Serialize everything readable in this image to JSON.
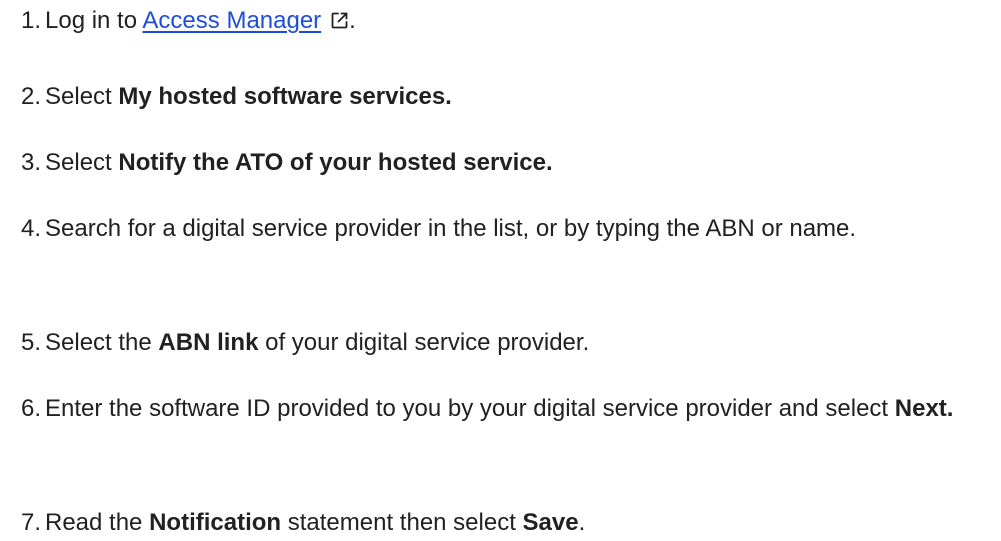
{
  "steps": [
    {
      "number": "1.",
      "before": "Log in to ",
      "link": "Access Manager",
      "link_icon": "external-link-icon",
      "after": "."
    },
    {
      "number": "2.",
      "before": "Select ",
      "bold": "My hosted software services."
    },
    {
      "number": "3.",
      "before": "Select ",
      "bold": "Notify the ATO of your hosted service."
    },
    {
      "number": "4.",
      "text": "Search for a digital service provider in the list, or by typing the ABN or name."
    },
    {
      "number": "5.",
      "before": "Select the ",
      "bold": "ABN link",
      "after": " of your digital service provider."
    },
    {
      "number": "6.",
      "before": "Enter the software ID provided to you by your digital service provider and select ",
      "bold": "Next."
    },
    {
      "number": "7.",
      "before": "Read the ",
      "bold": "Notification",
      "middle": " statement then select ",
      "bold2": "Save",
      "after": "."
    }
  ],
  "colors": {
    "text": "#212121",
    "link": "#1d4ed8",
    "background": "#ffffff"
  }
}
